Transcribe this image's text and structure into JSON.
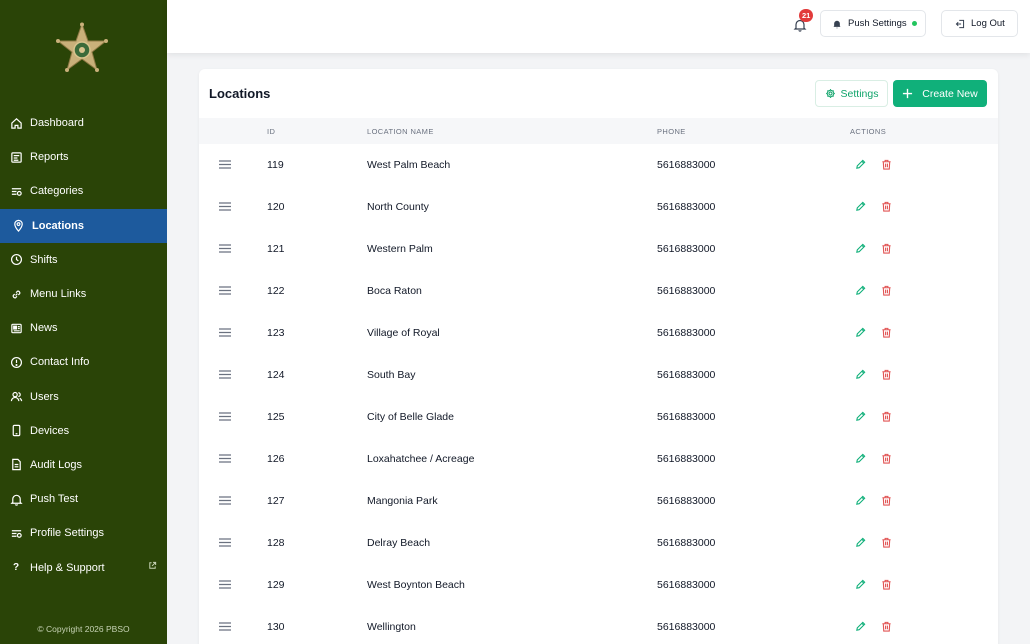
{
  "sidebar": {
    "items": [
      {
        "label": "Dashboard",
        "icon": "home-icon"
      },
      {
        "label": "Reports",
        "icon": "reports-icon"
      },
      {
        "label": "Categories",
        "icon": "categories-icon"
      },
      {
        "label": "Locations",
        "icon": "location-pin-icon",
        "active": true
      },
      {
        "label": "Shifts",
        "icon": "clock-icon"
      },
      {
        "label": "Menu Links",
        "icon": "link-icon"
      },
      {
        "label": "News",
        "icon": "news-icon"
      },
      {
        "label": "Contact Info",
        "icon": "info-circle-icon"
      },
      {
        "label": "Users",
        "icon": "users-icon"
      },
      {
        "label": "Devices",
        "icon": "device-icon"
      },
      {
        "label": "Audit Logs",
        "icon": "document-icon"
      },
      {
        "label": "Push Test",
        "icon": "bell-icon"
      },
      {
        "label": "Profile Settings",
        "icon": "profile-settings-icon"
      },
      {
        "label": "Help & Support",
        "icon": "question-mark-icon",
        "external": true
      }
    ],
    "copyright": "© Copyright 2026 PBSO"
  },
  "topbar": {
    "notification_count": "21",
    "push_settings_label": "Push Settings",
    "logout_label": "Log Out"
  },
  "card": {
    "title": "Locations",
    "settings_label": "Settings",
    "create_label": "Create New"
  },
  "table": {
    "headers": {
      "id": "ID",
      "name": "LOCATION NAME",
      "phone": "PHONE",
      "actions": "ACTIONS"
    },
    "rows": [
      {
        "id": "119",
        "name": "West Palm Beach",
        "phone": "5616883000"
      },
      {
        "id": "120",
        "name": "North County",
        "phone": "5616883000"
      },
      {
        "id": "121",
        "name": "Western Palm",
        "phone": "5616883000"
      },
      {
        "id": "122",
        "name": "Boca Raton",
        "phone": "5616883000"
      },
      {
        "id": "123",
        "name": "Village of Royal",
        "phone": "5616883000"
      },
      {
        "id": "124",
        "name": "South Bay",
        "phone": "5616883000"
      },
      {
        "id": "125",
        "name": "City of Belle Glade",
        "phone": "5616883000"
      },
      {
        "id": "126",
        "name": "Loxahatchee / Acreage",
        "phone": "5616883000"
      },
      {
        "id": "127",
        "name": "Mangonia Park",
        "phone": "5616883000"
      },
      {
        "id": "128",
        "name": "Delray Beach",
        "phone": "5616883000"
      },
      {
        "id": "129",
        "name": "West Boynton Beach",
        "phone": "5616883000"
      },
      {
        "id": "130",
        "name": "Wellington",
        "phone": "5616883000"
      }
    ]
  },
  "colors": {
    "sidebar_bg": "#2a4407",
    "active_item_bg": "#1d5a9d",
    "accent_green": "#10b07a",
    "delete_red": "#e25555",
    "badge_red": "#e23b3b"
  }
}
